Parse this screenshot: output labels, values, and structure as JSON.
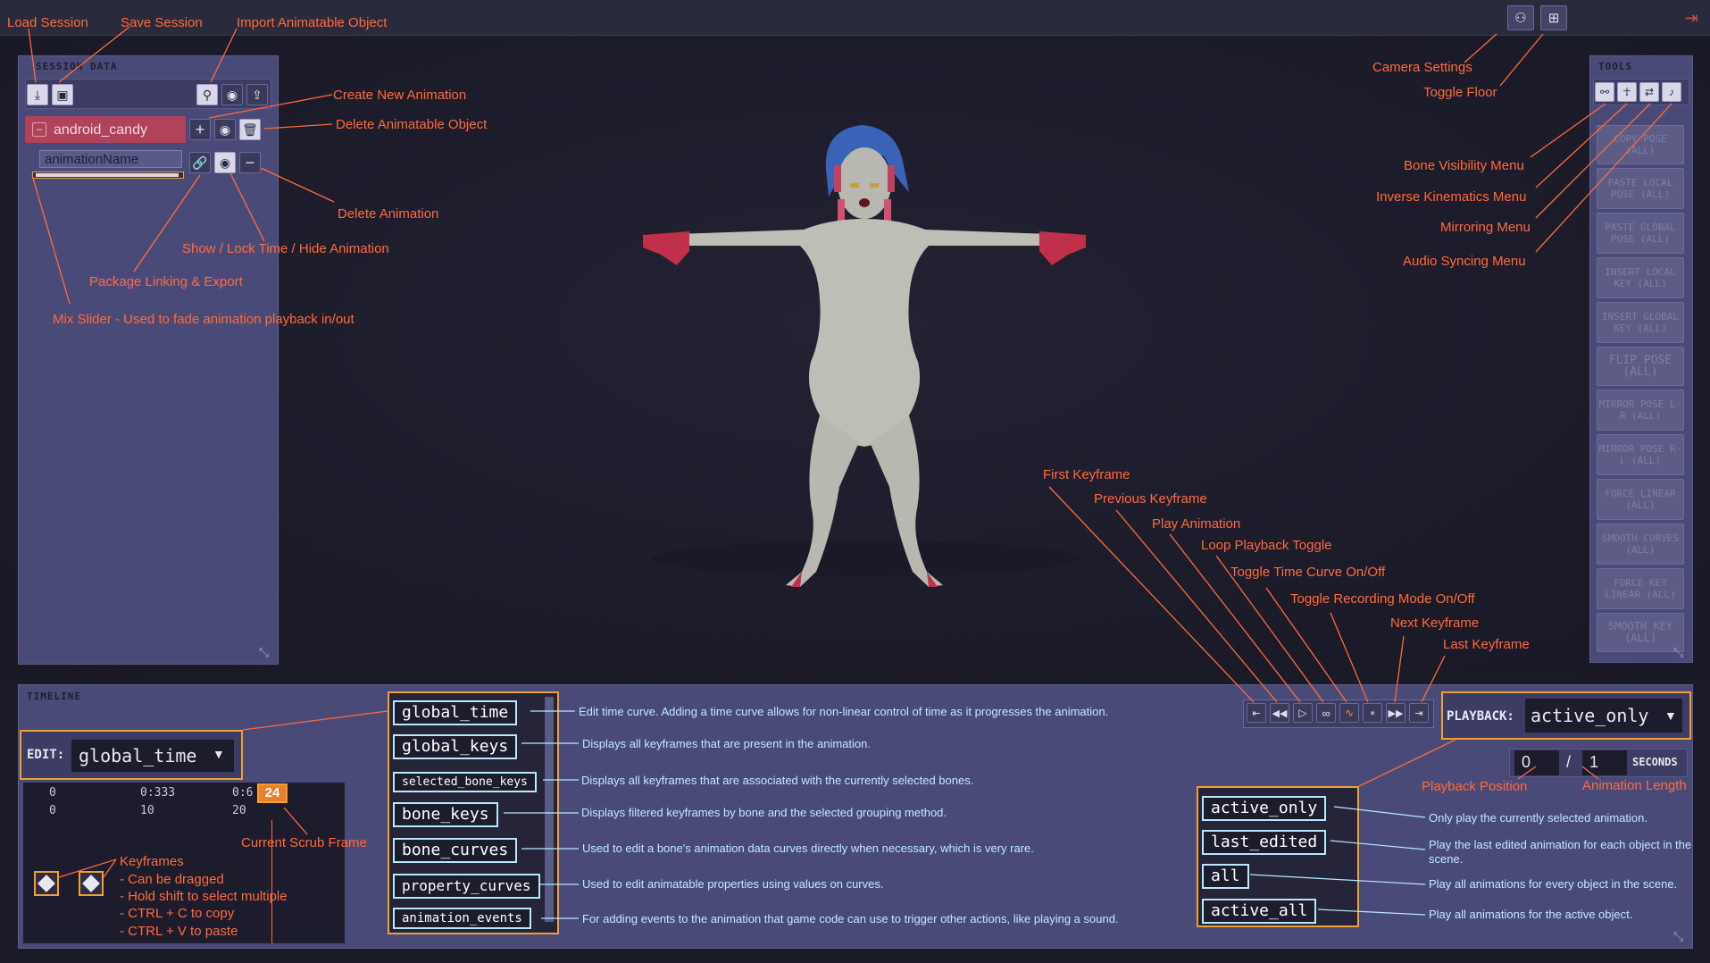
{
  "session_panel": {
    "title": "SESSION DATA",
    "object_name": "android_candy",
    "animation_name": "animationName"
  },
  "tools_panel": {
    "title": "TOOLS",
    "items": [
      "COPY POSE (ALL)",
      "PASTE LOCAL POSE (ALL)",
      "PASTE GLOBAL POSE (ALL)",
      "INSERT LOCAL KEY (ALL)",
      "INSERT GLOBAL KEY (ALL)",
      "FLIP POSE (ALL)",
      "MIRROR POSE L-R (ALL)",
      "MIRROR POSE R-L (ALL)",
      "FORCE LINEAR (ALL)",
      "SMOOTH CURVES (ALL)",
      "FORCE KEY LINEAR (ALL)",
      "SMOOTH KEY (ALL)"
    ]
  },
  "timeline": {
    "title": "TIMELINE",
    "edit_label": "EDIT:",
    "edit_value": "global_time",
    "ruler_top": [
      "0",
      "0:333",
      "0:6"
    ],
    "ruler_bottom": [
      "0",
      "10",
      "20"
    ],
    "scrub_frame": "24",
    "edit_options": [
      "global_time",
      "global_keys",
      "selected_bone_keys",
      "bone_keys",
      "bone_curves",
      "property_curves",
      "animation_events"
    ],
    "playback_label": "PLAYBACK:",
    "playback_value": "active_only",
    "position": "0",
    "separator": "/",
    "length": "1",
    "seconds": "SECONDS",
    "playback_options": [
      "active_only",
      "last_edited",
      "all",
      "active_all"
    ]
  },
  "annotations": {
    "load_session": "Load Session",
    "save_session": "Save Session",
    "import_object": "Import Animatable Object",
    "create_animation": "Create New Animation",
    "delete_object": "Delete Animatable Object",
    "delete_animation": "Delete Animation",
    "show_lock_hide": "Show / Lock Time / Hide Animation",
    "package_linking": "Package Linking & Export",
    "mix_slider": "Mix Slider - Used to fade animation playback in/out",
    "camera_settings": "Camera Settings",
    "toggle_floor": "Toggle Floor",
    "bone_visibility": "Bone Visibility Menu",
    "inverse_kinematics": "Inverse Kinematics Menu",
    "mirroring": "Mirroring Menu",
    "audio_syncing": "Audio Syncing Menu",
    "first_keyframe": "First Keyframe",
    "previous_keyframe": "Previous Keyframe",
    "play_animation": "Play Animation",
    "loop_toggle": "Loop Playback Toggle",
    "time_curve_toggle": "Toggle Time Curve On/Off",
    "recording_toggle": "Toggle Recording Mode On/Off",
    "next_keyframe": "Next Keyframe",
    "last_keyframe": "Last Keyframe",
    "playback_position": "Playback Position",
    "animation_length": "Animation Length",
    "current_scrub_frame": "Current Scrub Frame",
    "keyframes_title": "Keyframes",
    "keyframes_lines": [
      "- Can be dragged",
      "- Hold shift to select multiple",
      "- CTRL + C to copy",
      "- CTRL + V to paste"
    ],
    "edit_descriptions": [
      "Edit time curve. Adding a time curve allows for non-linear control of time as it progresses the animation.",
      "Displays all keyframes that are present in the animation.",
      "Displays all keyframes that are associated with the currently selected bones.",
      "Displays filtered keyframes by bone and the selected grouping method.",
      "Used to edit a bone's animation data curves directly when necessary, which is very rare.",
      "Used to edit animatable properties using values on curves.",
      "For adding events to the animation that game code can use to trigger other actions, like playing a sound."
    ],
    "playback_descriptions": [
      "Only play the currently selected animation.",
      "Play the last edited animation for each object in the scene.",
      "Play all animations for every object in the scene.",
      "Play all animations for the active object."
    ]
  },
  "colors": {
    "annotation": "#ff6a3c",
    "callout_box": "#f0a030",
    "panel": "#4a4a78",
    "background": "#1b1a28"
  }
}
